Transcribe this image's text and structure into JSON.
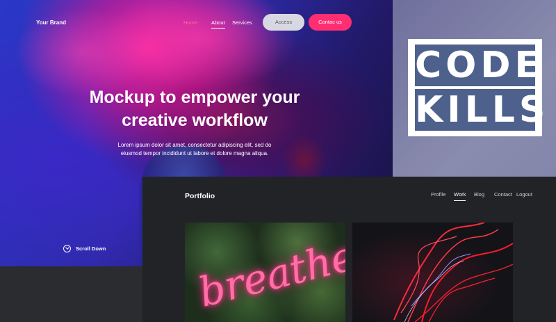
{
  "hero": {
    "brand": "Your Brand",
    "nav": [
      "Home",
      "About",
      "Services"
    ],
    "access_label": "Access",
    "contact_label": "Contac us",
    "title_line1": "Mockup to empower your",
    "title_line2": "creative workflow",
    "subtitle_line1": "Lorem ipsum dolor sit amet, consectetur adipiscing elit, sed do",
    "subtitle_line2": "eiusmod tempor incididunt ut labore et dolore magna aliqua.",
    "scroll_label": "Scroll Down"
  },
  "logo": {
    "line1": "CODE",
    "line2": "KILLS",
    "color": "#4e618c"
  },
  "portfolio": {
    "title": "Portfolio",
    "nav": [
      "Profile",
      "Work",
      "Blog",
      "Contact",
      "Logout"
    ],
    "active_nav": "Work",
    "card1_text": "breathe"
  },
  "colors": {
    "accent": "#ff2d72",
    "dark_bg": "#222326"
  }
}
